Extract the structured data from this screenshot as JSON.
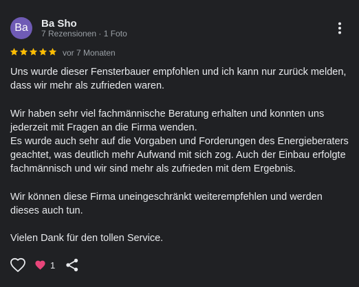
{
  "review": {
    "author": {
      "initials": "Ba",
      "name": "Ba Sho",
      "meta": "7 Rezensionen · 1 Foto",
      "avatar_color": "#6f5bb5"
    },
    "rating": 5,
    "rating_max": 5,
    "date": "vor 7 Monaten",
    "paragraphs": [
      "Uns wurde dieser Fensterbauer empfohlen und ich kann nur zurück melden, dass wir mehr als zufrieden waren.",
      "Wir haben sehr viel fachmännische Beratung erhalten und konnten uns jederzeit mit Fragen an die Firma wenden.\nEs wurde auch sehr auf die Vorgaben und Forderungen des Energieberaters geachtet, was deutlich mehr Aufwand mit sich zog. Auch der Einbau erfolgte fachmännisch und wir sind mehr als zufrieden mit dem Ergebnis.",
      "Wir können diese Firma uneingeschränkt weiterempfehlen und werden dieses auch tun.",
      "Vielen Dank für den tollen Service."
    ],
    "reactions": {
      "count": "1",
      "reaction_icon": "heart-icon",
      "reaction_color": "#e8457a"
    }
  },
  "colors": {
    "background": "#202124",
    "star": "#fbbc04",
    "text": "#e8eaed",
    "secondary_text": "#9aa0a6"
  },
  "icons": {
    "more": "more-vert-icon",
    "like": "heart-outline-icon",
    "share": "share-icon"
  }
}
